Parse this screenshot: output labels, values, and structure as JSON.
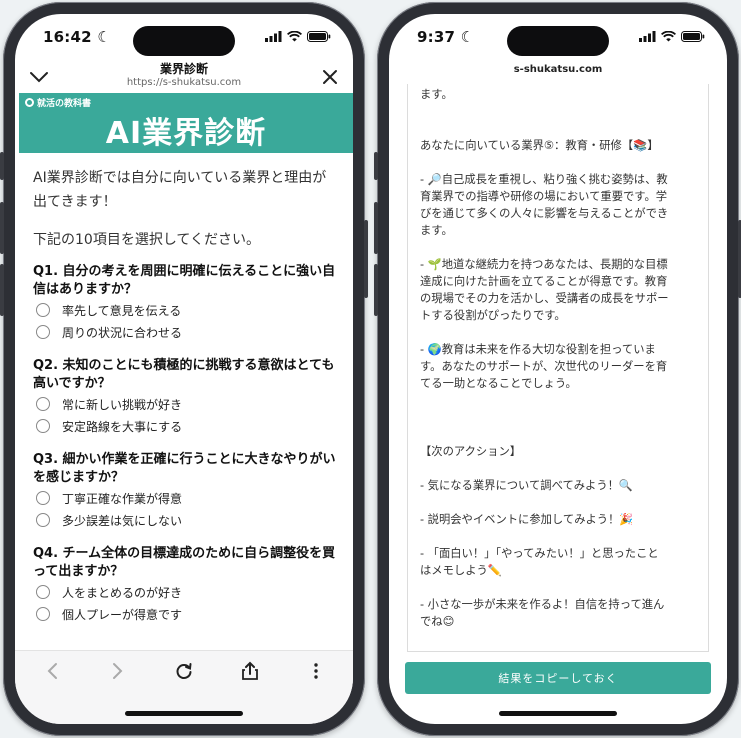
{
  "left": {
    "status_time": "16:42",
    "page_title": "業界診断",
    "url": "https://s-shukatsu.com",
    "brand": "就活の教科書",
    "banner_title": "AI業界診断",
    "intro": "AI業界診断では自分に向いている業界と理由が出てきます！",
    "instruction": "下記の10項目を選択してください。",
    "questions": [
      {
        "text": "Q1. 自分の考えを周囲に明確に伝えることに強い自信はありますか？",
        "options": [
          "率先して意見を伝える",
          "周りの状況に合わせる"
        ]
      },
      {
        "text": "Q2. 未知のことにも積極的に挑戦する意欲はとても高いですか？",
        "options": [
          "常に新しい挑戦が好き",
          "安定路線を大事にする"
        ]
      },
      {
        "text": "Q3. 細かい作業を正確に行うことに大きなやりがいを感じますか？",
        "options": [
          "丁寧正確な作業が得意",
          "多少誤差は気にしない"
        ]
      },
      {
        "text": "Q4. チーム全体の目標達成のために自ら調整役を買って出ますか？",
        "options": [
          "人をまとめるのが好き",
          "個人プレーが得意です"
        ]
      }
    ]
  },
  "right": {
    "status_time": "9:37",
    "url": "s-shukatsu.com",
    "result_lines": [
      "ます。",
      "",
      "",
      "あなたに向いている業界⑤：教育・研修【📚】",
      "",
      "- 🔎自己成長を重視し、粘り強く挑む姿勢は、教",
      "育業界での指導や研修の場において重要です。学",
      "びを通じて多くの人々に影響を与えることができ",
      "ます。",
      "",
      "- 🌱地道な継続力を持つあなたは、長期的な目標",
      "達成に向けた計画を立てることが得意です。教育",
      "の現場でその力を活かし、受講者の成長をサポー",
      "トする役割がぴったりです。",
      "",
      "- 🌍教育は未来を作る大切な役割を担っていま",
      "す。あなたのサポートが、次世代のリーダーを育",
      "てる一助となることでしょう。",
      "",
      "",
      "",
      "【次のアクション】",
      "",
      "- 気になる業界について調べてみよう！🔍",
      "",
      "- 説明会やイベントに参加してみよう！🎉",
      "",
      "- 「面白い！」「やってみたい！」と思ったこと",
      "はメモしよう✏️",
      "",
      "- 小さな一歩が未来を作るよ！自信を持って進ん",
      "でね😊"
    ],
    "copy_button": "結果をコピーしておく"
  }
}
